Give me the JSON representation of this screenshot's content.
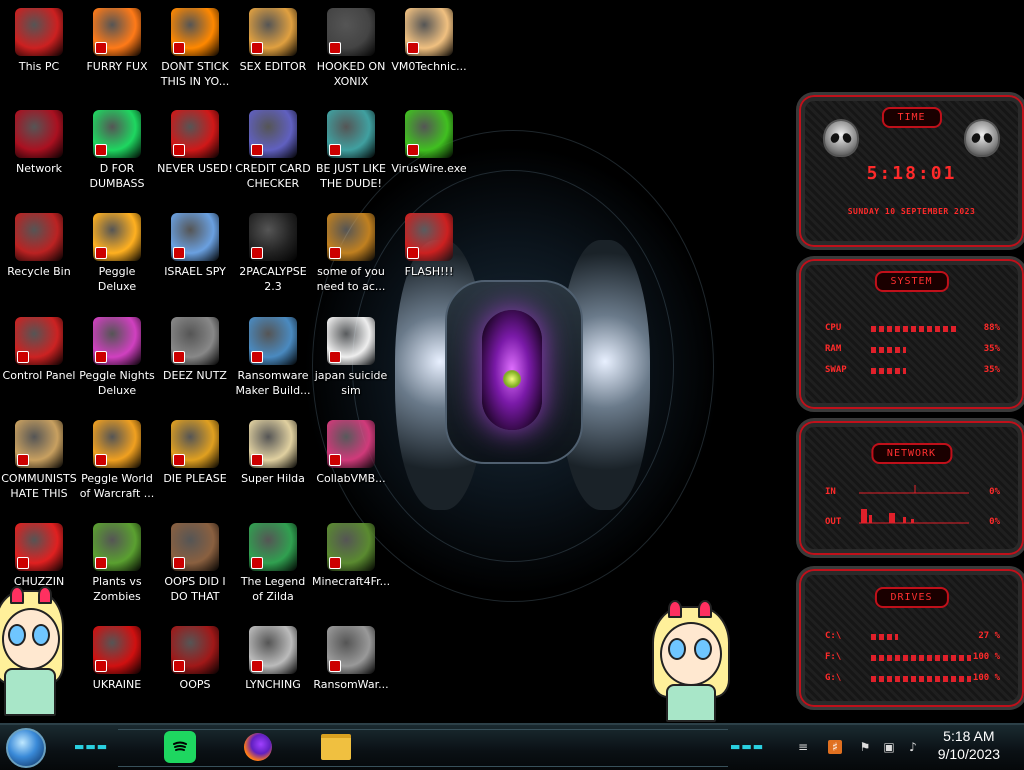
{
  "desktop_icons": [
    {
      "label": "This PC",
      "icon": "computer-icon",
      "color": "#cc2020"
    },
    {
      "label": "Network",
      "icon": "network-icon",
      "color": "#aa1020"
    },
    {
      "label": "Recycle Bin",
      "icon": "recycle-bin-icon",
      "color": "#b22"
    },
    {
      "label": "Control Panel",
      "icon": "control-panel-icon",
      "color": "#c22"
    },
    {
      "label": "COMMUNISTS HATE THIS G...",
      "icon": "money-bag-icon",
      "color": "#c8a060"
    },
    {
      "label": "CHUZZIN SUM",
      "icon": "chuzzle-icon",
      "color": "#e02020"
    },
    {
      "label": "FURRY FUX",
      "icon": "firefox-icon",
      "color": "#ff7a18"
    },
    {
      "label": "D FOR DUMBASS",
      "icon": "spotify-icon",
      "color": "#1ed760"
    },
    {
      "label": "Peggle Deluxe",
      "icon": "peggle-icon",
      "color": "#ffb020"
    },
    {
      "label": "Peggle Nights Deluxe",
      "icon": "peggle-nights-icon",
      "color": "#d040c0"
    },
    {
      "label": "Peggle World of Warcraft ...",
      "icon": "peggle-wow-icon",
      "color": "#f0a020"
    },
    {
      "label": "Plants vs Zombies",
      "icon": "plants-icon",
      "color": "#5aa030"
    },
    {
      "label": "UKRAINE",
      "icon": "radiation-icon",
      "color": "#d01010"
    },
    {
      "label": "DONT STICK THIS IN YO...",
      "icon": "vlc-icon",
      "color": "#ff8800"
    },
    {
      "label": "NEVER USED!",
      "icon": "dev-cpp-icon",
      "color": "#d01818"
    },
    {
      "label": "ISRAEL SPY",
      "icon": "network-share-icon",
      "color": "#6aa0e0"
    },
    {
      "label": "DEEZ NUTZ",
      "icon": "windows-stack-icon",
      "color": "#888"
    },
    {
      "label": "DIE PLEASE",
      "icon": "director-icon",
      "color": "#e0a020"
    },
    {
      "label": "OOPS DID I DO THAT",
      "icon": "portrait-icon",
      "color": "#8a6040"
    },
    {
      "label": "OOPS",
      "icon": "pc-skull-icon",
      "color": "#a01818"
    },
    {
      "label": "SEX EDITOR",
      "icon": "hxd-icon",
      "color": "#e0a040"
    },
    {
      "label": "CREDIT CARD CHECKER",
      "icon": "credit-card-icon",
      "color": "#6060c0"
    },
    {
      "label": "2PACALYPSE 2.3",
      "icon": "console-icon",
      "color": "#222"
    },
    {
      "label": "Ransomware Maker Build...",
      "icon": "window-app-icon",
      "color": "#4a8ac0"
    },
    {
      "label": "Super Hilda",
      "icon": "pixel-dog-icon",
      "color": "#e0d0a0"
    },
    {
      "label": "The Legend of Zilda",
      "icon": "pixel-hero-icon",
      "color": "#30a050"
    },
    {
      "label": "LYNCHING",
      "icon": "gear-cross-icon",
      "color": "#bbb"
    },
    {
      "label": "HOOKED ON XONIX",
      "icon": "xonix-icon",
      "color": "#444"
    },
    {
      "label": "BE JUST LIKE THE DUDE!",
      "icon": "santa-icon",
      "color": "#40a0a0"
    },
    {
      "label": "some of you need to ac...",
      "icon": "dog-cartoon-icon",
      "color": "#c08020"
    },
    {
      "label": "japan suicide sim",
      "icon": "file-icon",
      "color": "#eee"
    },
    {
      "label": "CollabVMB...",
      "icon": "collab-icon",
      "color": "#d03a7a"
    },
    {
      "label": "Minecraft4Fr...",
      "icon": "minecraft-icon",
      "color": "#5a8a30"
    },
    {
      "label": "RansomWar...",
      "icon": "skull-ring-icon",
      "color": "#999"
    },
    {
      "label": "VM0Technic...",
      "icon": "doctor-icon",
      "color": "#f0c080"
    },
    {
      "label": "VirusWire.exe",
      "icon": "limewire-icon",
      "color": "#40c020"
    },
    {
      "label": "FLASH!!!",
      "icon": "flash-file-icon",
      "color": "#cc2020"
    }
  ],
  "widgets": {
    "time": {
      "title": "TIME",
      "clock": "5:18:01",
      "date": "SUNDAY 10 SEPTEMBER 2023"
    },
    "system": {
      "title": "SYSTEM",
      "rows": [
        {
          "key": "CPU",
          "value": "88%",
          "level": 0.88
        },
        {
          "key": "RAM",
          "value": "35%",
          "level": 0.35
        },
        {
          "key": "SWAP",
          "value": "35%",
          "level": 0.35
        }
      ]
    },
    "network": {
      "title": "NETWORK",
      "rows": [
        {
          "key": "IN",
          "value": "0%"
        },
        {
          "key": "OUT",
          "value": "0%"
        }
      ]
    },
    "drives": {
      "title": "DRIVES",
      "rows": [
        {
          "key": "C:\\",
          "value": "27 %",
          "level": 0.27
        },
        {
          "key": "F:\\",
          "value": "100 %",
          "level": 1.0
        },
        {
          "key": "G:\\",
          "value": "100 %",
          "level": 1.0
        }
      ]
    }
  },
  "taskbar": {
    "pinned": [
      {
        "name": "spotify",
        "color": "#1ed760"
      },
      {
        "name": "firefox",
        "color": "#ff7a18"
      },
      {
        "name": "file-explorer",
        "color": "#f0c040"
      }
    ],
    "leds_left": "▬▬▬",
    "leds_right": "▬▬▬",
    "clock_time": "5:18 AM",
    "clock_date": "9/10/2023"
  },
  "colors": {
    "accent_red": "#e0202a",
    "taskbar_led": "#2ad0e0"
  }
}
